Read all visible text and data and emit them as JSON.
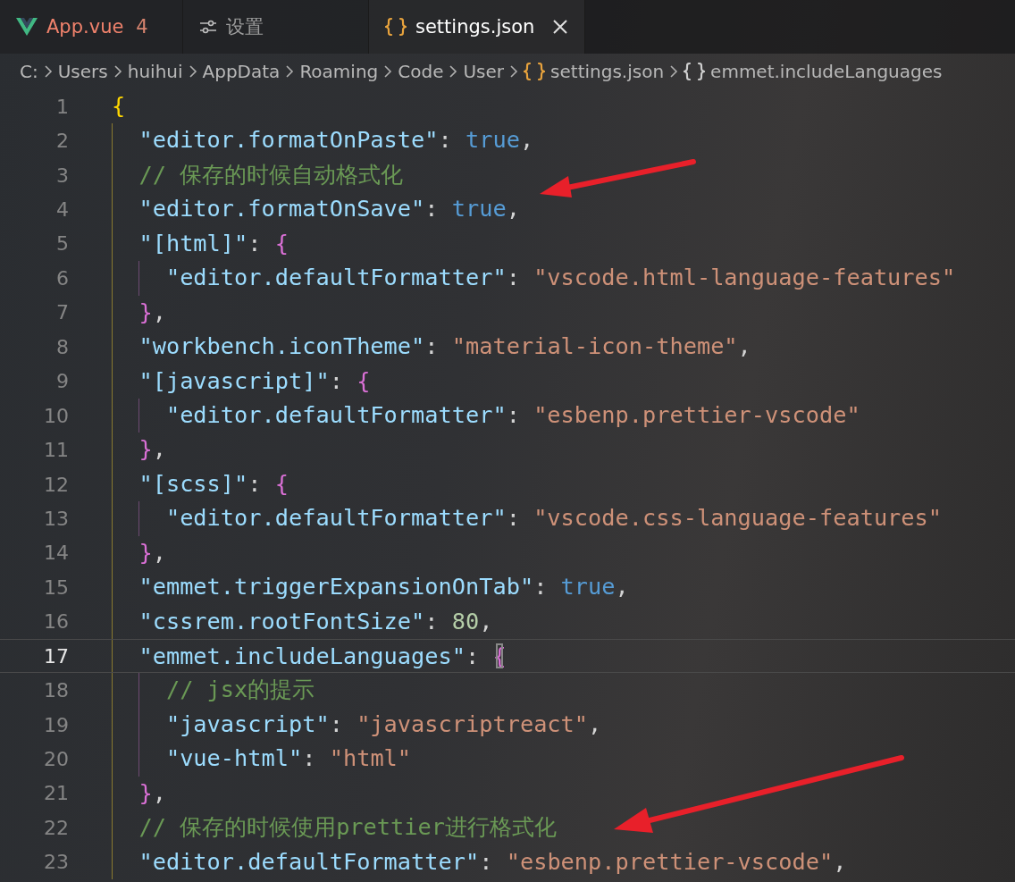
{
  "tabs": [
    {
      "label": "App.vue",
      "badge": "4",
      "selected": false
    },
    {
      "label": "设置",
      "selected": false
    },
    {
      "label": "settings.json",
      "selected": true
    }
  ],
  "breadcrumb": [
    {
      "label": "C:"
    },
    {
      "label": "Users"
    },
    {
      "label": "huihui"
    },
    {
      "label": "AppData"
    },
    {
      "label": "Roaming"
    },
    {
      "label": "Code"
    },
    {
      "label": "User"
    },
    {
      "label": "settings.json"
    },
    {
      "label": "emmet.includeLanguages"
    }
  ],
  "lines": [
    {
      "number": "1",
      "current": false,
      "tokens": [
        {
          "kind": "brace1",
          "text": "{"
        }
      ]
    },
    {
      "number": "2",
      "current": false,
      "tokens": [
        {
          "kind": "indent"
        },
        {
          "kind": "key",
          "text": "\"editor.formatOnPaste\""
        },
        {
          "kind": "punct",
          "text": ": "
        },
        {
          "kind": "bool",
          "text": "true"
        },
        {
          "kind": "punct",
          "text": ","
        }
      ]
    },
    {
      "number": "3",
      "current": false,
      "tokens": [
        {
          "kind": "indent"
        },
        {
          "kind": "comment",
          "text": "// 保存的时候自动格式化"
        }
      ]
    },
    {
      "number": "4",
      "current": false,
      "tokens": [
        {
          "kind": "indent"
        },
        {
          "kind": "key",
          "text": "\"editor.formatOnSave\""
        },
        {
          "kind": "punct",
          "text": ": "
        },
        {
          "kind": "bool",
          "text": "true"
        },
        {
          "kind": "punct",
          "text": ","
        }
      ]
    },
    {
      "number": "5",
      "current": false,
      "tokens": [
        {
          "kind": "indent"
        },
        {
          "kind": "key",
          "text": "\"[html]\""
        },
        {
          "kind": "punct",
          "text": ": "
        },
        {
          "kind": "brace2",
          "text": "{"
        }
      ]
    },
    {
      "number": "6",
      "current": false,
      "tokens": [
        {
          "kind": "indent"
        },
        {
          "kind": "nested"
        },
        {
          "kind": "key",
          "text": "\"editor.defaultFormatter\""
        },
        {
          "kind": "punct",
          "text": ": "
        },
        {
          "kind": "string",
          "text": "\"vscode.html-language-features\""
        }
      ]
    },
    {
      "number": "7",
      "current": false,
      "tokens": [
        {
          "kind": "indent"
        },
        {
          "kind": "brace2",
          "text": "}"
        },
        {
          "kind": "punct",
          "text": ","
        }
      ]
    },
    {
      "number": "8",
      "current": false,
      "tokens": [
        {
          "kind": "indent"
        },
        {
          "kind": "key",
          "text": "\"workbench.iconTheme\""
        },
        {
          "kind": "punct",
          "text": ": "
        },
        {
          "kind": "string",
          "text": "\"material-icon-theme\""
        },
        {
          "kind": "punct",
          "text": ","
        }
      ]
    },
    {
      "number": "9",
      "current": false,
      "tokens": [
        {
          "kind": "indent"
        },
        {
          "kind": "key",
          "text": "\"[javascript]\""
        },
        {
          "kind": "punct",
          "text": ": "
        },
        {
          "kind": "brace2",
          "text": "{"
        }
      ]
    },
    {
      "number": "10",
      "current": false,
      "tokens": [
        {
          "kind": "indent"
        },
        {
          "kind": "nested"
        },
        {
          "kind": "key",
          "text": "\"editor.defaultFormatter\""
        },
        {
          "kind": "punct",
          "text": ": "
        },
        {
          "kind": "string",
          "text": "\"esbenp.prettier-vscode\""
        }
      ]
    },
    {
      "number": "11",
      "current": false,
      "tokens": [
        {
          "kind": "indent"
        },
        {
          "kind": "brace2",
          "text": "}"
        },
        {
          "kind": "punct",
          "text": ","
        }
      ]
    },
    {
      "number": "12",
      "current": false,
      "tokens": [
        {
          "kind": "indent"
        },
        {
          "kind": "key",
          "text": "\"[scss]\""
        },
        {
          "kind": "punct",
          "text": ": "
        },
        {
          "kind": "brace2",
          "text": "{"
        }
      ]
    },
    {
      "number": "13",
      "current": false,
      "tokens": [
        {
          "kind": "indent"
        },
        {
          "kind": "nested"
        },
        {
          "kind": "key",
          "text": "\"editor.defaultFormatter\""
        },
        {
          "kind": "punct",
          "text": ": "
        },
        {
          "kind": "string",
          "text": "\"vscode.css-language-features\""
        }
      ]
    },
    {
      "number": "14",
      "current": false,
      "tokens": [
        {
          "kind": "indent"
        },
        {
          "kind": "brace2",
          "text": "}"
        },
        {
          "kind": "punct",
          "text": ","
        }
      ]
    },
    {
      "number": "15",
      "current": false,
      "tokens": [
        {
          "kind": "indent"
        },
        {
          "kind": "key",
          "text": "\"emmet.triggerExpansionOnTab\""
        },
        {
          "kind": "punct",
          "text": ": "
        },
        {
          "kind": "bool",
          "text": "true"
        },
        {
          "kind": "punct",
          "text": ","
        }
      ]
    },
    {
      "number": "16",
      "current": false,
      "tokens": [
        {
          "kind": "indent"
        },
        {
          "kind": "key",
          "text": "\"cssrem.rootFontSize\""
        },
        {
          "kind": "punct",
          "text": ": "
        },
        {
          "kind": "number",
          "text": "80"
        },
        {
          "kind": "punct",
          "text": ","
        }
      ]
    },
    {
      "number": "17",
      "current": true,
      "tokens": [
        {
          "kind": "indent"
        },
        {
          "kind": "key",
          "text": "\"emmet.includeLanguages\""
        },
        {
          "kind": "punct",
          "text": ": "
        },
        {
          "kind": "cursorbrace",
          "text": "{"
        }
      ]
    },
    {
      "number": "18",
      "current": false,
      "tokens": [
        {
          "kind": "indent"
        },
        {
          "kind": "nested"
        },
        {
          "kind": "comment",
          "text": "// jsx的提示"
        }
      ]
    },
    {
      "number": "19",
      "current": false,
      "tokens": [
        {
          "kind": "indent"
        },
        {
          "kind": "nested"
        },
        {
          "kind": "key",
          "text": "\"javascript\""
        },
        {
          "kind": "punct",
          "text": ": "
        },
        {
          "kind": "string",
          "text": "\"javascriptreact\""
        },
        {
          "kind": "punct",
          "text": ","
        }
      ]
    },
    {
      "number": "20",
      "current": false,
      "tokens": [
        {
          "kind": "indent"
        },
        {
          "kind": "nested"
        },
        {
          "kind": "key",
          "text": "\"vue-html\""
        },
        {
          "kind": "punct",
          "text": ": "
        },
        {
          "kind": "string",
          "text": "\"html\""
        }
      ]
    },
    {
      "number": "21",
      "current": false,
      "tokens": [
        {
          "kind": "indent"
        },
        {
          "kind": "brace2",
          "text": "}"
        },
        {
          "kind": "punct",
          "text": ","
        }
      ]
    },
    {
      "number": "22",
      "current": false,
      "tokens": [
        {
          "kind": "indent"
        },
        {
          "kind": "comment",
          "text": "// 保存的时候使用prettier进行格式化"
        }
      ]
    },
    {
      "number": "23",
      "current": false,
      "tokens": [
        {
          "kind": "indent"
        },
        {
          "kind": "key",
          "text": "\"editor.defaultFormatter\""
        },
        {
          "kind": "punct",
          "text": ": "
        },
        {
          "kind": "string",
          "text": "\"esbenp.prettier-vscode\""
        },
        {
          "kind": "punct",
          "text": ","
        }
      ]
    }
  ]
}
